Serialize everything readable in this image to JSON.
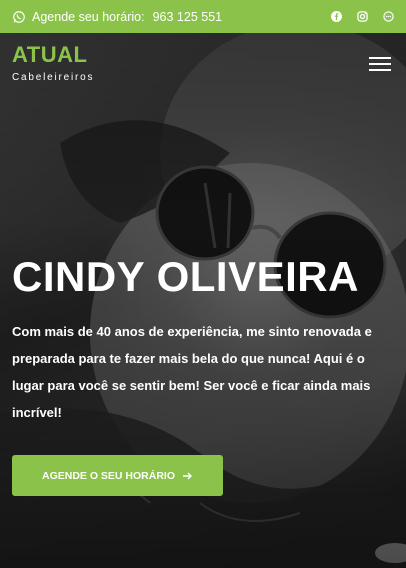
{
  "topbar": {
    "schedule_label": "Agende seu horário:",
    "phone": "963 125 551",
    "social": [
      "facebook-icon",
      "instagram-icon",
      "whatsapp-icon"
    ],
    "bg_color": "#8bc34a"
  },
  "logo": {
    "name": "ATUAL",
    "subtitle": "Cabeleireiros"
  },
  "hero": {
    "title": "CINDY OLIVEIRA",
    "description": "Com mais de 40 anos de experiência, me sinto renovada e preparada para te fazer mais bela do que nunca! Aqui é o lugar para você se sentir bem! Ser você e ficar ainda mais incrível!",
    "cta_label": "AGENDE O SEU HORÁRIO",
    "cta_icon": "arrow-right-icon"
  },
  "colors": {
    "accent": "#8bc34a",
    "text": "#ffffff"
  }
}
